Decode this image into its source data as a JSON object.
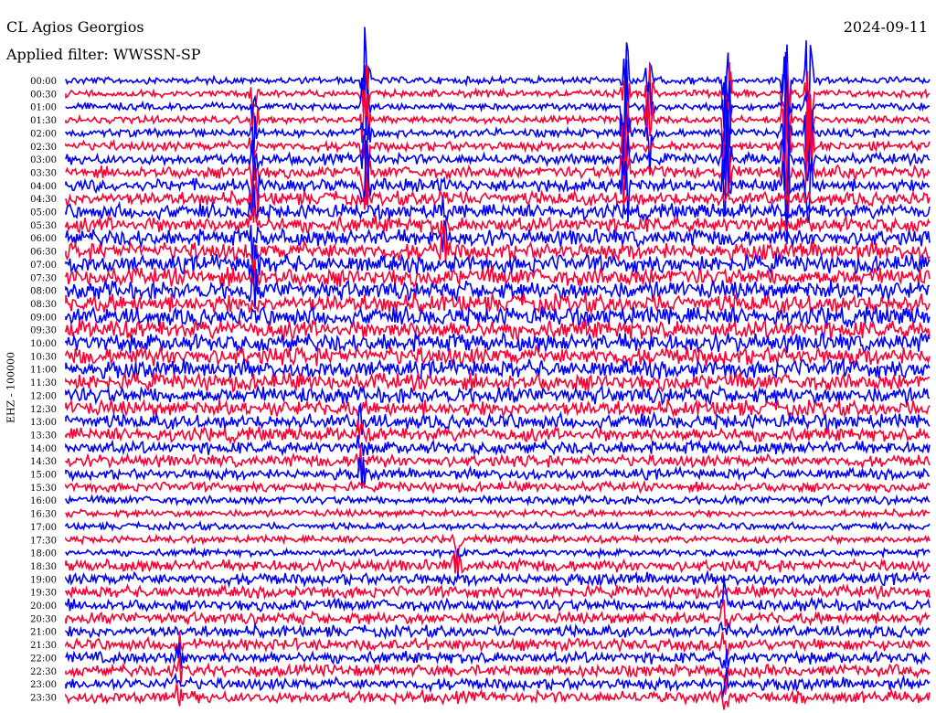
{
  "header": {
    "station": "CL Agios Georgios",
    "filter": "Applied filter: WWSSN-SP",
    "date": "2024-09-11"
  },
  "chart_data": {
    "type": "helicorder",
    "title": "CL Agios Georgios",
    "subtitle": "Applied filter: WWSSN-SP",
    "date": "2024-09-11",
    "ylabel": "EHZ - 100000",
    "rows": [
      "00:00",
      "00:30",
      "01:00",
      "01:30",
      "02:00",
      "02:30",
      "03:00",
      "03:30",
      "04:00",
      "04:30",
      "05:00",
      "05:30",
      "06:00",
      "06:30",
      "07:00",
      "07:30",
      "08:00",
      "08:30",
      "09:00",
      "09:30",
      "10:00",
      "10:30",
      "11:00",
      "11:30",
      "12:00",
      "12:30",
      "13:00",
      "13:30",
      "14:00",
      "14:30",
      "15:00",
      "15:30",
      "16:00",
      "16:30",
      "17:00",
      "17:30",
      "18:00",
      "18:30",
      "19:00",
      "19:30",
      "20:00",
      "20:30",
      "21:00",
      "21:30",
      "22:00",
      "22:30",
      "23:00",
      "23:30"
    ],
    "series_colors": [
      "#0000ff",
      "#ff0033"
    ],
    "background": "#ffffff"
  }
}
